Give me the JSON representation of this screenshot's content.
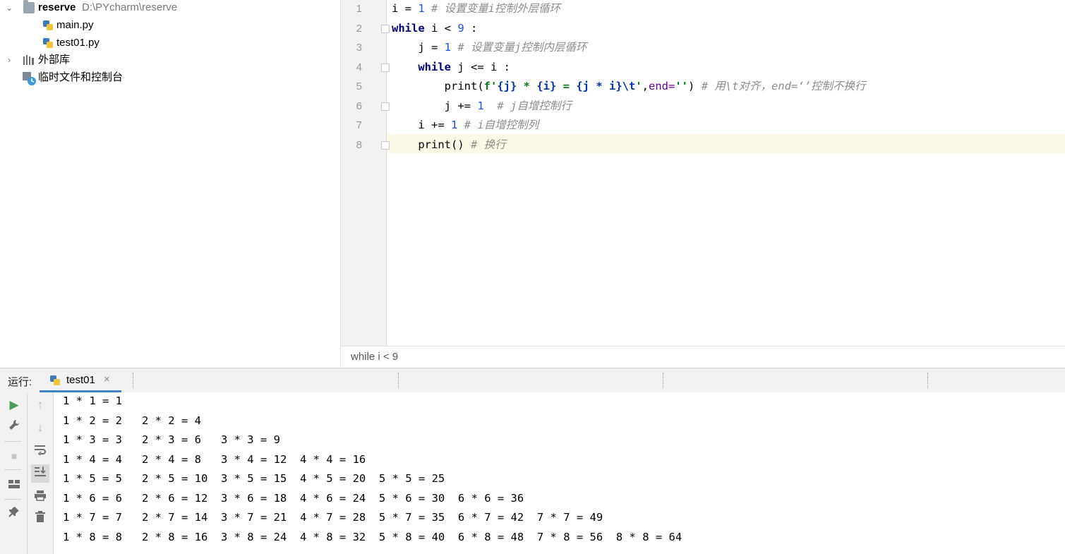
{
  "project_tree": {
    "root_name": "reserve",
    "root_path": "D:\\PYcharm\\reserve",
    "files": [
      "main.py",
      "test01.py"
    ],
    "external_libs": "外部库",
    "scratches": "临时文件和控制台"
  },
  "editor": {
    "line_numbers": [
      "1",
      "2",
      "3",
      "4",
      "5",
      "6",
      "7",
      "8"
    ],
    "lines": [
      [
        "i = ",
        "1",
        " # 设置变量i控制外层循环"
      ],
      [
        "while",
        " i < ",
        "9",
        " :"
      ],
      [
        "    j = ",
        "1",
        " # 设置变量j控制内层循环"
      ],
      [
        "    ",
        "while",
        " j <= i :"
      ],
      [
        "        print(",
        "f'",
        "{j}",
        " * ",
        "{i}",
        " = ",
        "{j * i}",
        "\\t",
        "'",
        ",",
        "end=",
        "''",
        ")",
        " # 用\\t对齐，end=‘’控制不换行"
      ],
      [
        "        j += ",
        "1",
        "  # j自增控制行"
      ],
      [
        "    i += ",
        "1",
        " # i自增控制列"
      ],
      [
        "    print()",
        " # 换行"
      ]
    ],
    "breadcrumb": "while i < 9"
  },
  "run_panel": {
    "label": "运行:",
    "tab_name": "test01",
    "close_glyph": "×",
    "output": [
      "1 * 1 = 1",
      "1 * 2 = 2   2 * 2 = 4",
      "1 * 3 = 3   2 * 3 = 6   3 * 3 = 9",
      "1 * 4 = 4   2 * 4 = 8   3 * 4 = 12  4 * 4 = 16",
      "1 * 5 = 5   2 * 5 = 10  3 * 5 = 15  4 * 5 = 20  5 * 5 = 25",
      "1 * 6 = 6   2 * 6 = 12  3 * 6 = 18  4 * 6 = 24  5 * 6 = 30  6 * 6 = 36",
      "1 * 7 = 7   2 * 7 = 14  3 * 7 = 21  4 * 7 = 28  5 * 7 = 35  6 * 7 = 42  7 * 7 = 49",
      "1 * 8 = 8   2 * 8 = 16  3 * 8 = 24  4 * 8 = 32  5 * 8 = 40  6 * 8 = 48  7 * 8 = 56  8 * 8 = 64"
    ]
  },
  "icons": {
    "expand": "chevron-down-icon",
    "collapse": "chevron-right-icon",
    "run": "play-icon",
    "settings": "wrench-icon",
    "stop": "stop-icon",
    "layout": "layout-icon",
    "pin": "pin-icon",
    "up": "arrow-up-icon",
    "down": "arrow-down-icon",
    "wrap": "soft-wrap-icon",
    "scroll": "scroll-to-end-icon",
    "print": "print-icon",
    "trash": "trash-icon"
  },
  "colors": {
    "keyword": "#000080",
    "number": "#1750eb",
    "comment": "#8c8c8c",
    "string": "#067d17",
    "run_green": "#499c54",
    "tab_accent": "#4083c9"
  }
}
